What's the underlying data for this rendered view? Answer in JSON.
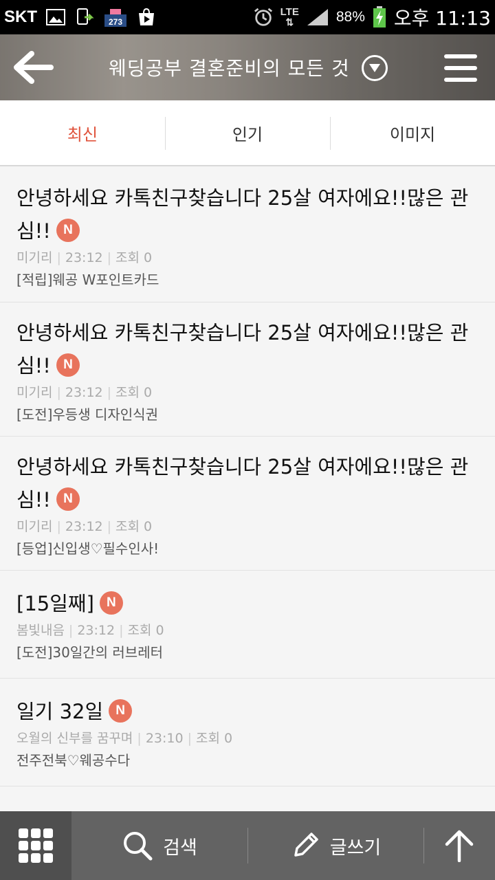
{
  "status_bar": {
    "carrier": "SKT",
    "calendar_badge": "273",
    "network": "LTE",
    "battery": "88%",
    "time": "오후 11:13"
  },
  "header": {
    "title": "웨딩공부 결혼준비의 모든 것"
  },
  "tabs": [
    {
      "label": "최신",
      "active": true
    },
    {
      "label": "인기",
      "active": false
    },
    {
      "label": "이미지",
      "active": false
    }
  ],
  "badge_label": "N",
  "colors": {
    "accent": "#e0533c",
    "badge": "#e8735c",
    "bottom_bar": "#636363"
  },
  "posts": [
    {
      "title": "안녕하세요 카톡친구찾습니다 25살 여자에요!!많은 관심!!",
      "author": "미기리",
      "time": "23:12",
      "views": "조회 0",
      "board": "[적립]웨공 W포인트카드"
    },
    {
      "title": "안녕하세요 카톡친구찾습니다 25살 여자에요!!많은 관심!!",
      "author": "미기리",
      "time": "23:12",
      "views": "조회 0",
      "board": "[도전]우등생 디자인식권"
    },
    {
      "title": "안녕하세요 카톡친구찾습니다 25살 여자에요!!많은 관심!!",
      "author": "미기리",
      "time": "23:12",
      "views": "조회 0",
      "board": "[등업]신입생♡필수인사!"
    },
    {
      "title": "[15일째]",
      "author": "봄빛내음",
      "time": "23:12",
      "views": "조회 0",
      "board": "[도전]30일간의 러브레터"
    },
    {
      "title": "일기 32일",
      "author": "오월의 신부를 꿈꾸며",
      "time": "23:10",
      "views": "조회 0",
      "board": "전주전북♡웨공수다"
    }
  ],
  "bottom_bar": {
    "search_label": "검색",
    "write_label": "글쓰기"
  }
}
